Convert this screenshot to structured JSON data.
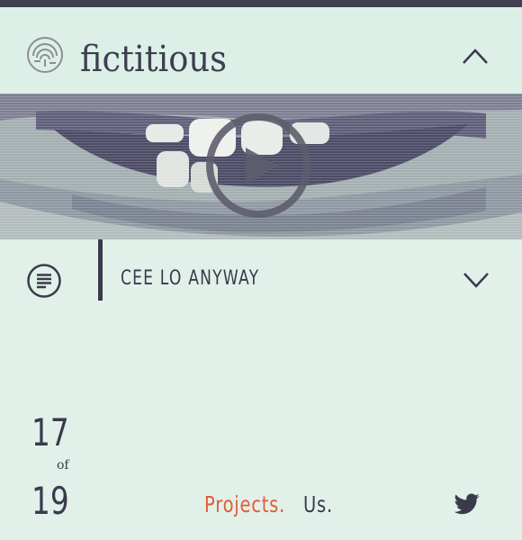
{
  "brand": {
    "name": "fictitious",
    "logo_icon": "fingerprint-circle-logo-icon"
  },
  "header": {
    "collapse_icon": "chevron-up-icon"
  },
  "video": {
    "play_icon": "play-circle-icon",
    "description": "video thumbnail"
  },
  "track": {
    "list_icon": "list-circle-icon",
    "title": "CEE LO ANYWAY",
    "expand_icon": "chevron-down-icon"
  },
  "counter": {
    "current": "17",
    "of_label": "of",
    "total": "19"
  },
  "nav": {
    "projects_label": "Projects.",
    "us_label": "Us.",
    "twitter_icon": "twitter-bird-icon"
  },
  "colors": {
    "background": "#e1f1ea",
    "ink": "#3a3a4c",
    "accent": "#e65a35",
    "topbar": "#404052"
  }
}
